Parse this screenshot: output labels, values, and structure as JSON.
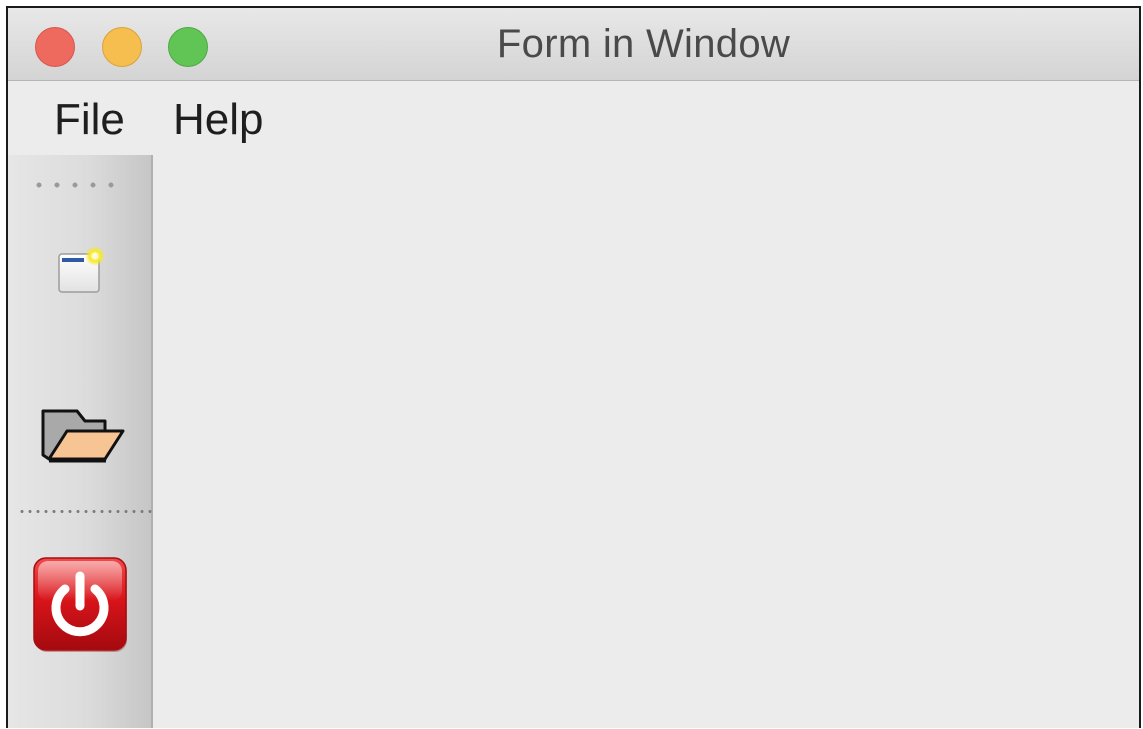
{
  "window": {
    "title": "Form in Window"
  },
  "menubar": {
    "items": [
      {
        "label": "File"
      },
      {
        "label": "Help"
      }
    ]
  },
  "toolbar": {
    "buttons": [
      {
        "icon": "new-window-icon"
      },
      {
        "icon": "open-folder-icon"
      },
      {
        "icon": "power-icon"
      }
    ]
  },
  "colors": {
    "close": "#ee6a5f",
    "minimize": "#f5be4f",
    "zoom": "#61c555",
    "background": "#ececec",
    "power_button": "#d8141a"
  }
}
